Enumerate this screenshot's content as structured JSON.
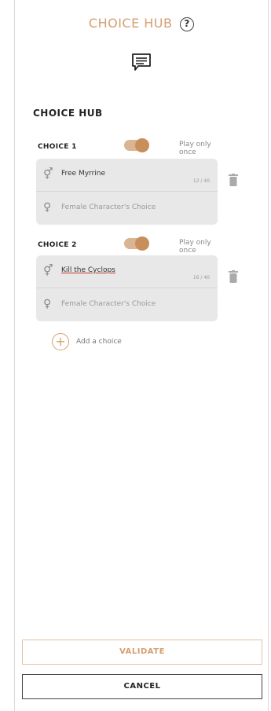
{
  "header": {
    "title": "CHOICE HUB",
    "help_icon": "question-circle-icon",
    "dialog_icon": "chat-bubble-icon",
    "accent_color": "#d49f70"
  },
  "section": {
    "title": "CHOICE HUB"
  },
  "choices": [
    {
      "label": "CHOICE 1",
      "toggle_label": "Play only once",
      "toggle_on": true,
      "male_text": "Free Myrrine",
      "male_counter": "12 / 40",
      "female_placeholder": "Female Character's Choice"
    },
    {
      "label": "CHOICE 2",
      "toggle_label": "Play only once",
      "toggle_on": true,
      "male_text": "Kill the Cyclops",
      "male_counter": "16 / 40",
      "female_placeholder": "Female Character's Choice"
    }
  ],
  "add_choice": {
    "label": "Add a choice",
    "icon": "plus-circle-icon"
  },
  "buttons": {
    "validate": "VALIDATE",
    "cancel": "CANCEL"
  }
}
